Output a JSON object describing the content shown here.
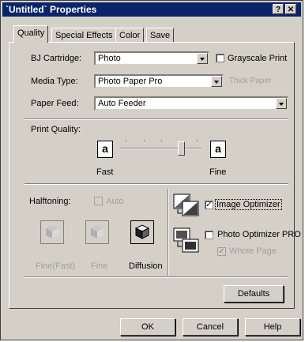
{
  "window": {
    "title": "`Untitled` Properties",
    "help_glyph": "?",
    "close_glyph": "✕"
  },
  "tabs": [
    {
      "label": "Quality"
    },
    {
      "label": "Special Effects"
    },
    {
      "label": "Color"
    },
    {
      "label": "Save"
    }
  ],
  "bj_cartridge": {
    "label": "BJ Cartridge:",
    "value": "Photo"
  },
  "grayscale": {
    "label": "Grayscale Print",
    "checked": false
  },
  "media_type": {
    "label": "Media Type:",
    "value": "Photo Paper Pro"
  },
  "thick_paper": {
    "label": "Thick Paper",
    "enabled": false
  },
  "paper_feed": {
    "label": "Paper Feed:",
    "value": "Auto Feeder"
  },
  "print_quality": {
    "label": "Print Quality:",
    "fast": "Fast",
    "fine": "Fine",
    "glyph": "a"
  },
  "halftoning": {
    "label": "Halftoning:",
    "auto_label": "Auto",
    "options": [
      {
        "label": "Fine(Fast)",
        "enabled": false
      },
      {
        "label": "Fine",
        "enabled": false
      },
      {
        "label": "Diffusion",
        "enabled": true
      }
    ]
  },
  "image_optimizer": {
    "label": "Image Optimizer",
    "checked": true
  },
  "photo_optimizer": {
    "label": "Photo Optimizer PRO",
    "checked": false
  },
  "whole_page": {
    "label": "Whole Page",
    "checked": true,
    "enabled": false
  },
  "buttons": {
    "defaults": "Defaults",
    "ok": "OK",
    "cancel": "Cancel",
    "help": "Help"
  }
}
